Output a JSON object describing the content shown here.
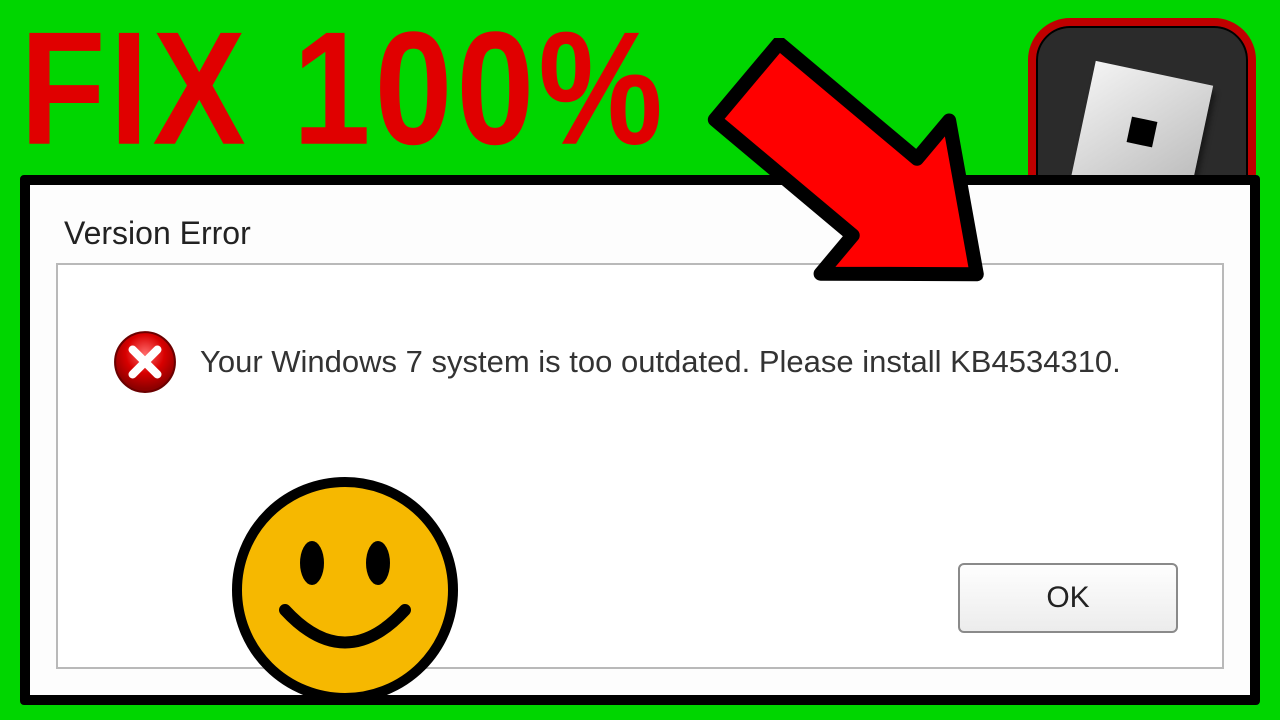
{
  "headline": "FIX 100%",
  "dialog": {
    "title": "Version Error",
    "message": "Your Windows 7 system is too outdated. Please install KB4534310.",
    "ok_label": "OK"
  },
  "icons": {
    "error": "error-circle-x",
    "smiley": "smiley-face",
    "app_badge": "roblox-icon",
    "arrow": "red-pointer-arrow"
  },
  "colors": {
    "bg": "#00D600",
    "accent_red": "#E00000",
    "arrow_red": "#FF0000",
    "black": "#000000",
    "smiley_yellow": "#F6B800"
  }
}
